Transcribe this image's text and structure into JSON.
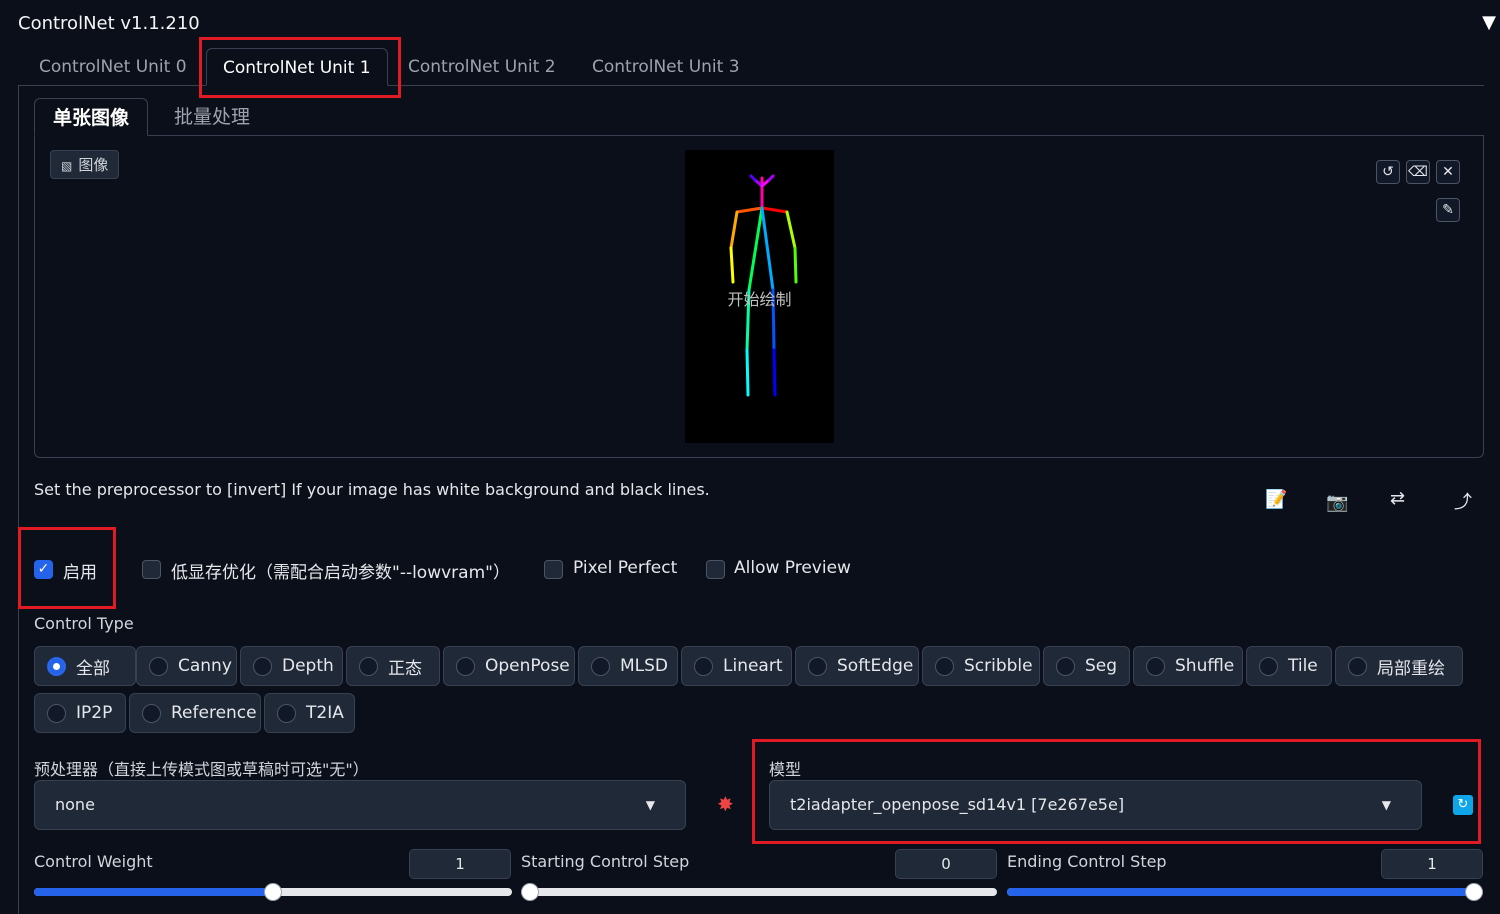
{
  "header": {
    "title": "ControlNet v1.1.210",
    "collapse_icon": "▼"
  },
  "unit_tabs": [
    "ControlNet Unit 0",
    "ControlNet Unit 1",
    "ControlNet Unit 2",
    "ControlNet Unit 3"
  ],
  "image_tabs": [
    "单张图像",
    "批量处理"
  ],
  "image_panel": {
    "label": "图像",
    "canvas_hint": "开始绘制"
  },
  "hint": "Set the preprocessor to [invert] If your image has white background and black lines.",
  "checkboxes": {
    "enable": "启用",
    "lowvram": "低显存优化（需配合启动参数\"--lowvram\"）",
    "pixel_perfect": "Pixel Perfect",
    "allow_preview": "Allow Preview"
  },
  "control_type": {
    "label": "Control Type",
    "options": [
      "全部",
      "Canny",
      "Depth",
      "正态",
      "OpenPose",
      "MLSD",
      "Lineart",
      "SoftEdge",
      "Scribble",
      "Seg",
      "Shuffle",
      "Tile",
      "局部重绘",
      "IP2P",
      "Reference",
      "T2IA"
    ],
    "selected": "全部"
  },
  "preprocessor": {
    "label": "预处理器（直接上传模式图或草稿时可选\"无\"）",
    "value": "none"
  },
  "model": {
    "label": "模型",
    "value": "t2iadapter_openpose_sd14v1 [7e267e5e]"
  },
  "sliders": {
    "weight": {
      "label": "Control Weight",
      "value": "1",
      "fraction": 0.5
    },
    "start": {
      "label": "Starting Control Step",
      "value": "0",
      "fraction": 0
    },
    "end": {
      "label": "Ending Control Step",
      "value": "1",
      "fraction": 1
    }
  },
  "colors": {
    "accent": "#2563eb",
    "highlight": "#e01b24",
    "background": "#0b0f19"
  }
}
